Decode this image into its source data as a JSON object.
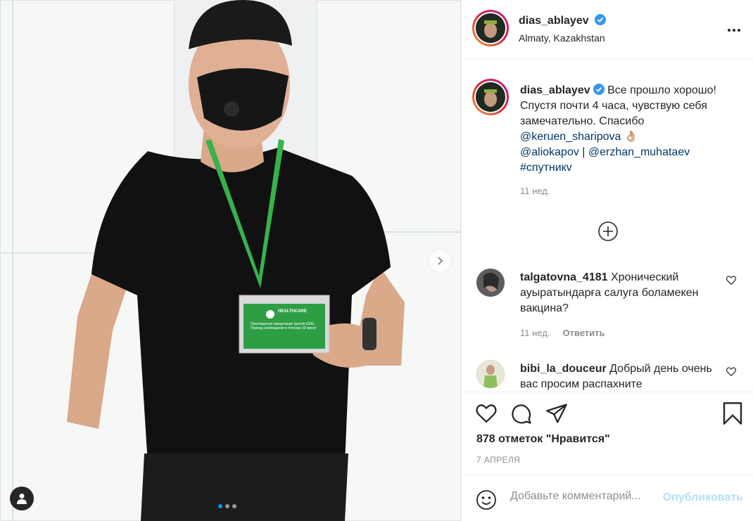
{
  "post": {
    "author": "dias_ablayev",
    "location": "Almaty, Kazakhstan",
    "verified": true,
    "image": {
      "badge_logo_text": "HEALTHCARE",
      "badge_text": "Прохождение вакцинации против SSKL Период наблюдения в течение 30 минут",
      "carousel_count": 3,
      "carousel_active": 1
    },
    "caption": {
      "text": "Все прошло хорошо! Спустя почти 4 часа, чувствую себя замечательно. Спасибо",
      "mention_1": "@keruen_sharipova",
      "emoji": "👌🏼",
      "mention_2": "@aliokapov",
      "separator": " | ",
      "mention_3": "@erzhan_muhataev",
      "hashtag": "#спутникv",
      "time": "11 нед."
    },
    "comments": [
      {
        "username": "talgatovna_4181",
        "text": "Хронический ауыратындарға салуга боламекен вакцина?",
        "time": "11 нед.",
        "reply_label": "Ответить"
      },
      {
        "username": "bibi_la_douceur",
        "text": "Добрый день очень вас просим распахните"
      }
    ],
    "likes_text": "878 отметок \"Нравится\"",
    "date": "7 АПРЕЛЯ",
    "add_comment": {
      "placeholder": "Добавьте комментарий...",
      "post_label": "Опубликовать"
    }
  },
  "colors": {
    "link": "#00376b",
    "verified_blue": "#3897f0",
    "secondary_text": "#8e8e8e",
    "active_dot": "#0095f6",
    "post_button_disabled": "#b2dffc"
  }
}
